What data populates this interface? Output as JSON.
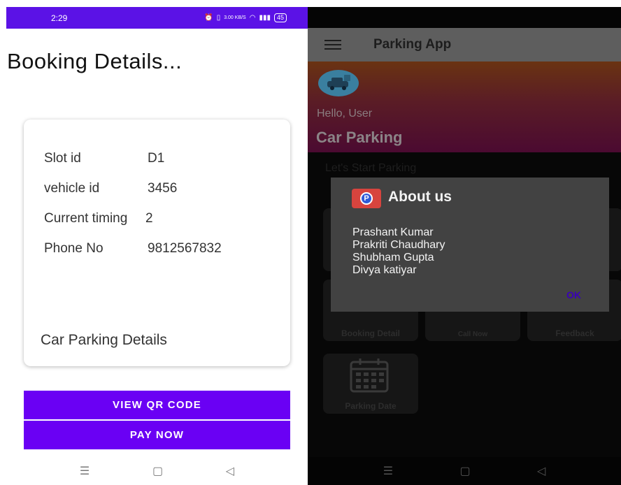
{
  "left": {
    "status_bar": {
      "time": "2:29",
      "speed": "3.00 KB/S",
      "battery": "45"
    },
    "page_title": "Booking Details...",
    "details": [
      {
        "label": "Slot id",
        "value": "D1"
      },
      {
        "label": "vehicle id",
        "value": "3456"
      },
      {
        "label": "Current timing",
        "value": "2"
      },
      {
        "label": "Phone No",
        "value": "9812567832"
      }
    ],
    "card_footer": "Car Parking Details",
    "buttons": {
      "view_qr": "VIEW QR CODE",
      "pay_now": "PAY NOW"
    }
  },
  "right": {
    "app_title": "Parking App",
    "greeting": "Hello, User",
    "header_title": "Car Parking",
    "subtitle": "Let's Start Parking",
    "tiles": {
      "booking_detail": "Booking Detail",
      "call_now": "Call Now",
      "feedback": "Feedback",
      "parking_date": "Parking Date"
    },
    "dialog": {
      "title": "About us",
      "names": [
        "Prashant Kumar",
        "Prakriti Chaudhary",
        "Shubham Gupta",
        "Divya katiyar"
      ],
      "ok": "OK"
    }
  },
  "icons": {
    "nav_menu": "menu-icon",
    "nav_home": "home-icon",
    "nav_back": "back-icon",
    "hamburger": "hamburger-icon",
    "avatar": "car-parking-icon",
    "dialog": "parking-pin-icon",
    "calendar": "calendar-icon"
  },
  "colors": {
    "accent": "#6a00f4",
    "status_bar": "#5b12e6",
    "dialog_bg": "#424242"
  }
}
